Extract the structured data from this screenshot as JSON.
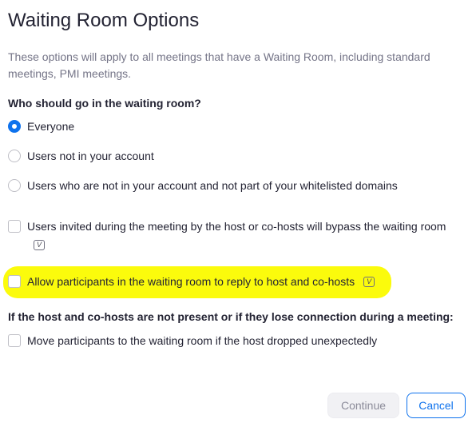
{
  "dialog": {
    "title": "Waiting Room Options",
    "description": "These options will apply to all meetings that have a Waiting Room, including standard meetings, PMI meetings."
  },
  "who_section": {
    "heading": "Who should go in the waiting room?",
    "options": [
      {
        "label": "Everyone",
        "selected": true
      },
      {
        "label": "Users not in your account",
        "selected": false
      },
      {
        "label": "Users who are not in your account and not part of your whitelisted domains",
        "selected": false
      }
    ]
  },
  "checkboxes": [
    {
      "label": "Users invited during the meeting by the host or co-hosts will bypass the waiting room",
      "checked": false,
      "badge_icon": "video-badge-icon"
    },
    {
      "label": "Allow participants in the waiting room to reply to host and co-hosts",
      "checked": false,
      "badge_icon": "video-badge-icon",
      "highlighted": true
    }
  ],
  "host_section": {
    "heading": "If the host and co-hosts are not present or if they lose connection during a meeting:",
    "option": {
      "label": "Move participants to the waiting room if the host dropped unexpectedly",
      "checked": false
    }
  },
  "buttons": {
    "continue": "Continue",
    "cancel": "Cancel"
  },
  "colors": {
    "accent": "#0e72ed",
    "highlight": "#fbfb0c",
    "muted_text": "#747487"
  }
}
